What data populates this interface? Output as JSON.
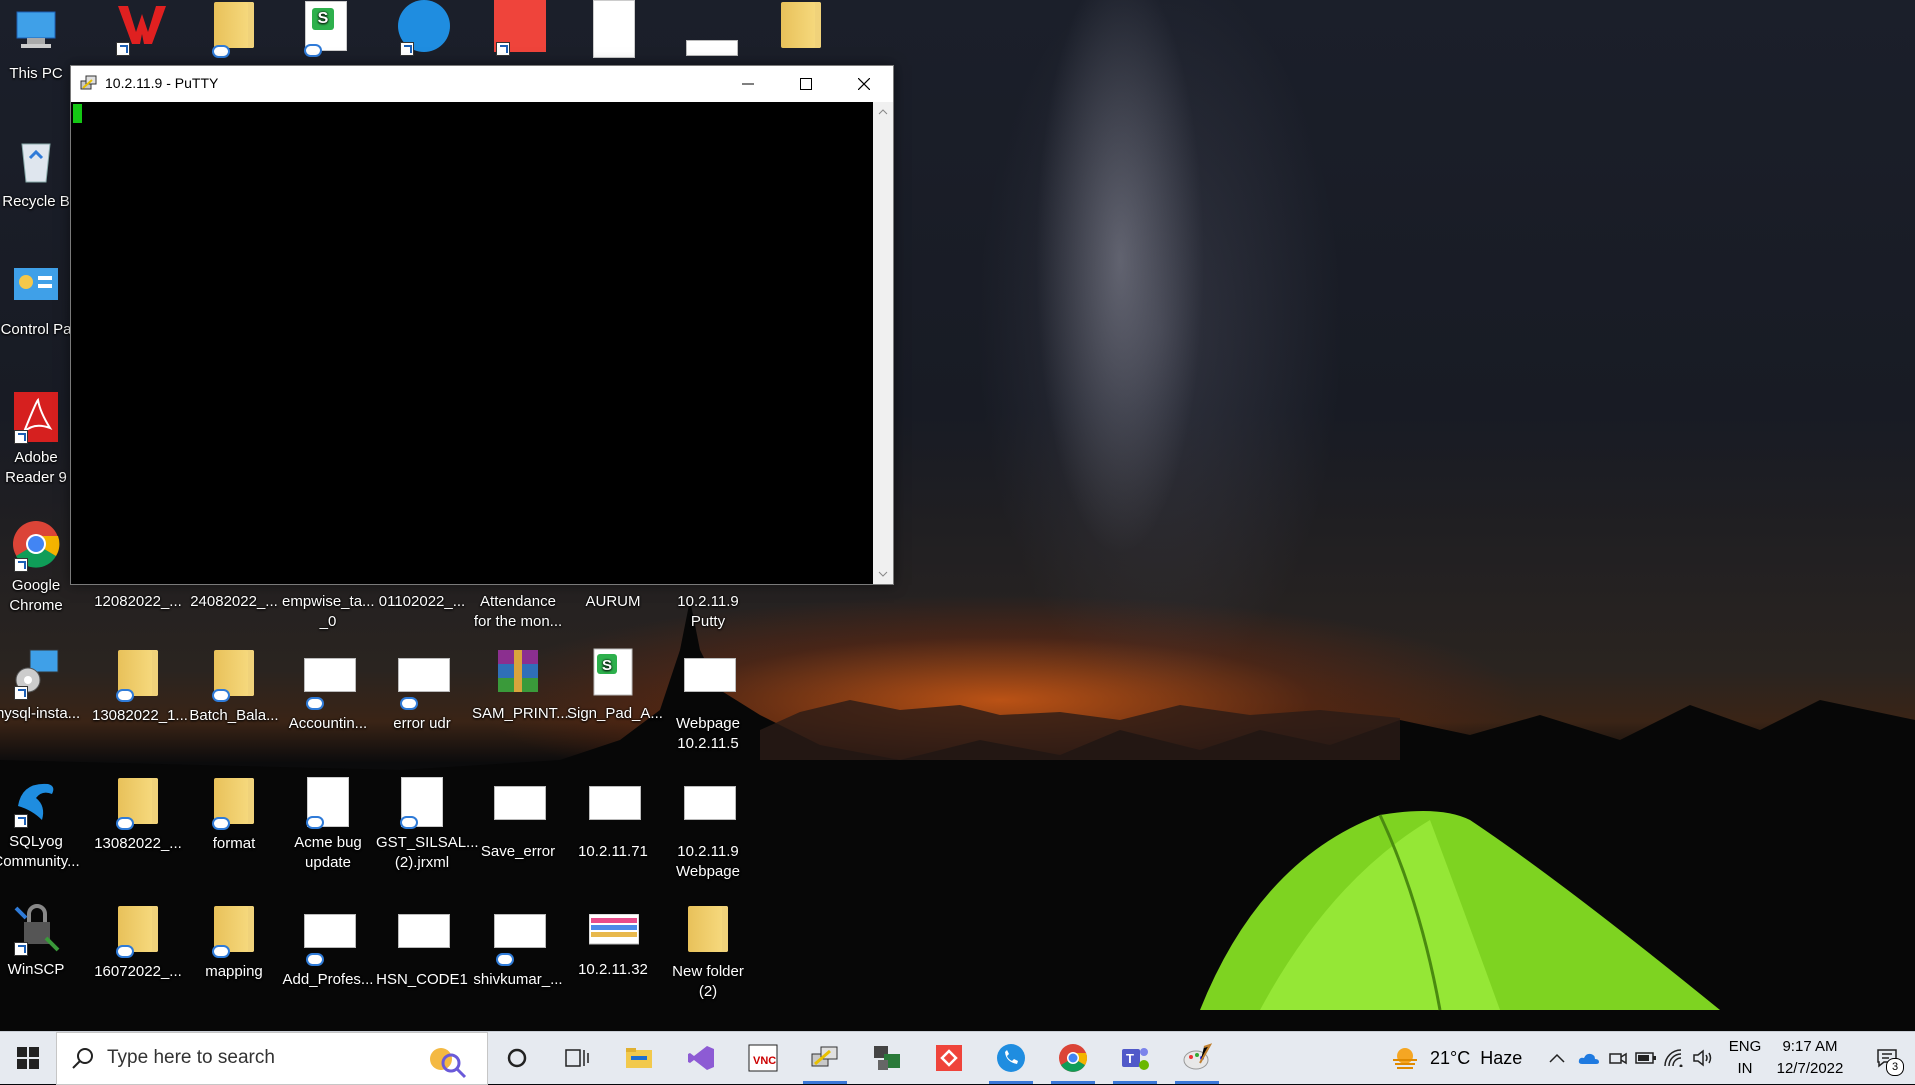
{
  "desktop": {
    "icons": [
      {
        "id": "this-pc",
        "label": "This PC"
      },
      {
        "id": "recycle-bin",
        "label": "Recycle B"
      },
      {
        "id": "control-panel",
        "label": "Control Pa"
      },
      {
        "id": "adobe-reader",
        "label": "Adobe\nReader 9"
      },
      {
        "id": "google-chrome",
        "label": "Google\nChrome"
      },
      {
        "id": "12082022",
        "label": "12082022_..."
      },
      {
        "id": "24082022",
        "label": "24082022_..."
      },
      {
        "id": "empwise",
        "label": "empwise_ta...\n_0"
      },
      {
        "id": "01102022",
        "label": "01102022_..."
      },
      {
        "id": "attendance",
        "label": "Attendance\nfor the mon..."
      },
      {
        "id": "aurum",
        "label": "AURUM"
      },
      {
        "id": "putty-shortcut",
        "label": "10.2.11.9\nPutty"
      },
      {
        "id": "mysql-installer",
        "label": "mysql-insta..."
      },
      {
        "id": "13082022-1",
        "label": "13082022_1..."
      },
      {
        "id": "batch-bala",
        "label": "Batch_Bala..."
      },
      {
        "id": "accounting",
        "label": "Accountin..."
      },
      {
        "id": "error-udr",
        "label": "error udr"
      },
      {
        "id": "sam-print",
        "label": "SAM_PRINT..."
      },
      {
        "id": "sign-pad",
        "label": "Sign_Pad_A..."
      },
      {
        "id": "webpage-10-2-11-5",
        "label": "Webpage\n10.2.11.5"
      },
      {
        "id": "sqlyog",
        "label": "SQLyog\nCommunity..."
      },
      {
        "id": "13082022-2",
        "label": "13082022_..."
      },
      {
        "id": "format",
        "label": "format"
      },
      {
        "id": "acme-bug",
        "label": "Acme bug\nupdate"
      },
      {
        "id": "gst-silsal",
        "label": "GST_SILSAL...\n(2).jrxml"
      },
      {
        "id": "save-error",
        "label": "Save_error"
      },
      {
        "id": "ip-10-2-11-71",
        "label": "10.2.11.71"
      },
      {
        "id": "webpage-10-2-11-9",
        "label": "10.2.11.9\nWebpage"
      },
      {
        "id": "winscp",
        "label": "WinSCP"
      },
      {
        "id": "16072022",
        "label": "16072022_..."
      },
      {
        "id": "mapping",
        "label": "mapping"
      },
      {
        "id": "add-profes",
        "label": "Add_Profes..."
      },
      {
        "id": "hsn-code1",
        "label": "HSN_CODE1"
      },
      {
        "id": "shivkumar",
        "label": "shivkumar_..."
      },
      {
        "id": "ip-10-2-11-32",
        "label": "10.2.11.32"
      },
      {
        "id": "new-folder-2",
        "label": "New folder\n(2)"
      }
    ]
  },
  "putty": {
    "title": "10.2.11.9 - PuTTY"
  },
  "taskbar": {
    "search_placeholder": "Type here to search",
    "weather": {
      "temp": "21°C",
      "condition": "Haze"
    },
    "lang": {
      "line1": "ENG",
      "line2": "IN"
    },
    "clock": {
      "time": "9:17 AM",
      "date": "12/7/2022"
    },
    "notification_count": "3"
  },
  "colors": {
    "taskbar_bg": "#e6eaf0",
    "active_indicator": "#3b78d8",
    "cursor": "#14c814"
  }
}
